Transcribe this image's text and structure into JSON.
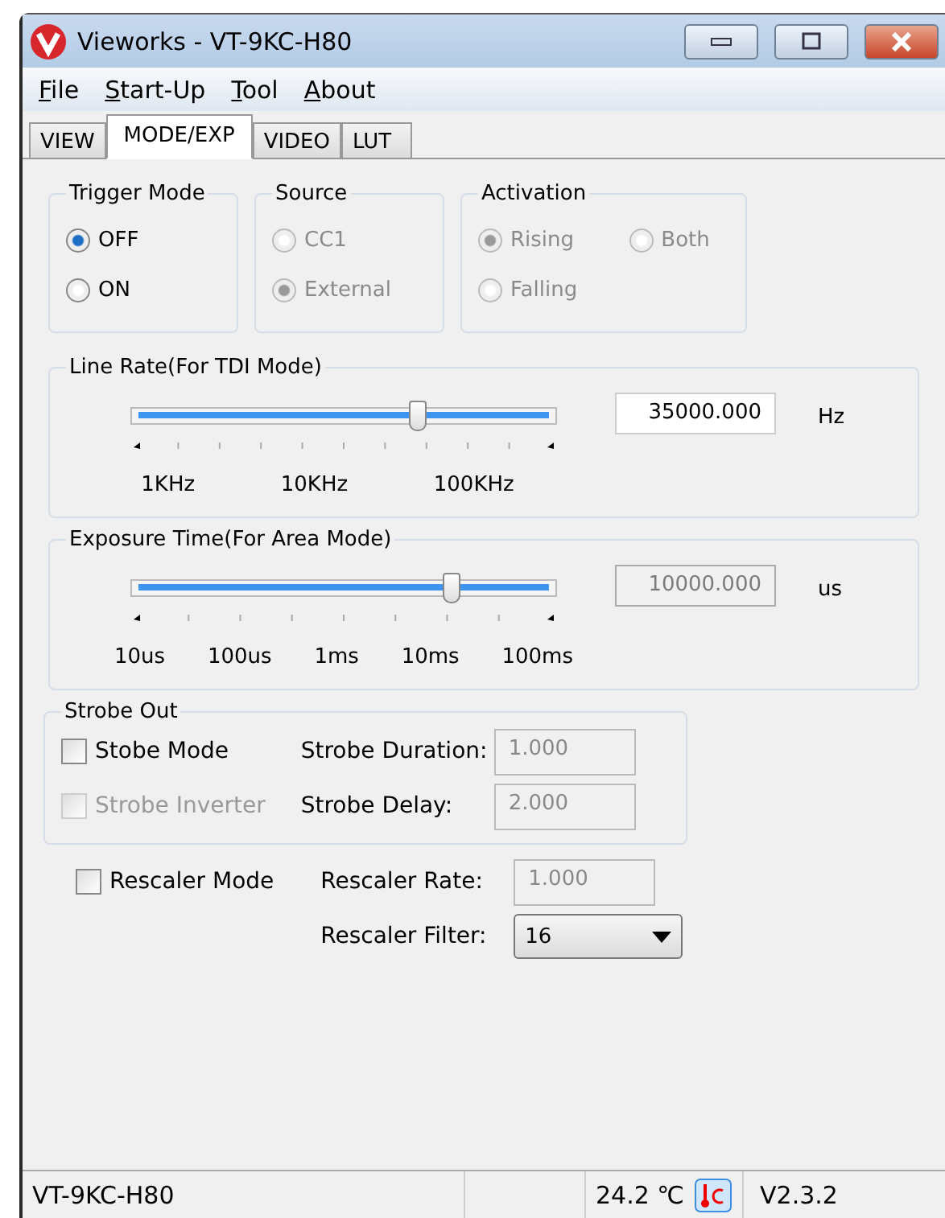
{
  "window": {
    "title": "Vieworks - VT-9KC-H80"
  },
  "menu": [
    "File",
    "Start-Up",
    "Tool",
    "About"
  ],
  "tabs": [
    {
      "label": "VIEW",
      "selected": false
    },
    {
      "label": "MODE/EXP",
      "selected": true
    },
    {
      "label": "VIDEO",
      "selected": false
    },
    {
      "label": "LUT",
      "selected": false
    }
  ],
  "trigger_mode": {
    "title": "Trigger Mode",
    "options": [
      {
        "label": "OFF",
        "selected": true
      },
      {
        "label": "ON",
        "selected": false
      }
    ]
  },
  "source": {
    "title": "Source",
    "disabled": true,
    "options": [
      {
        "label": "CC1",
        "selected": false
      },
      {
        "label": "External",
        "selected": true
      }
    ]
  },
  "activation": {
    "title": "Activation",
    "disabled": true,
    "options": [
      {
        "label": "Rising",
        "selected": true
      },
      {
        "label": "Both",
        "selected": false
      },
      {
        "label": "Falling",
        "selected": false
      }
    ]
  },
  "line_rate": {
    "title": "Line Rate(For TDI Mode)",
    "level": 0.67,
    "value": "35000.000",
    "unit": "Hz",
    "disabled": false,
    "scale": [
      "1KHz",
      "10KHz",
      "100KHz"
    ]
  },
  "exposure_time": {
    "title": "Exposure Time(For Area Mode)",
    "level": 0.75,
    "value": "10000.000",
    "unit": "us",
    "disabled": true,
    "scale": [
      "10us",
      "100us",
      "1ms",
      "10ms",
      "100ms"
    ]
  },
  "strobe_out": {
    "title": "Strobe Out",
    "checkboxes": [
      {
        "label": "Stobe Mode",
        "checked": false,
        "disabled": false
      },
      {
        "label": "Strobe Inverter",
        "checked": false,
        "disabled": true
      }
    ],
    "fields": [
      {
        "label": "Strobe Duration:",
        "value": "1.000",
        "kind": "text",
        "disabled": true
      },
      {
        "label": "Strobe Delay:",
        "value": "2.000",
        "kind": "text",
        "disabled": true
      }
    ]
  },
  "rescaler": {
    "checkbox": {
      "label": "Rescaler Mode",
      "checked": false,
      "disabled": false
    },
    "fields": [
      {
        "label": "Rescaler Rate:",
        "value": "1.000",
        "kind": "text",
        "disabled": true
      },
      {
        "label": "Rescaler Filter:",
        "value": "16",
        "kind": "dropdown"
      }
    ]
  },
  "status_bar": {
    "model": "VT-9KC-H80",
    "temperature": "24.2 ℃",
    "version": "V2.3.2"
  }
}
